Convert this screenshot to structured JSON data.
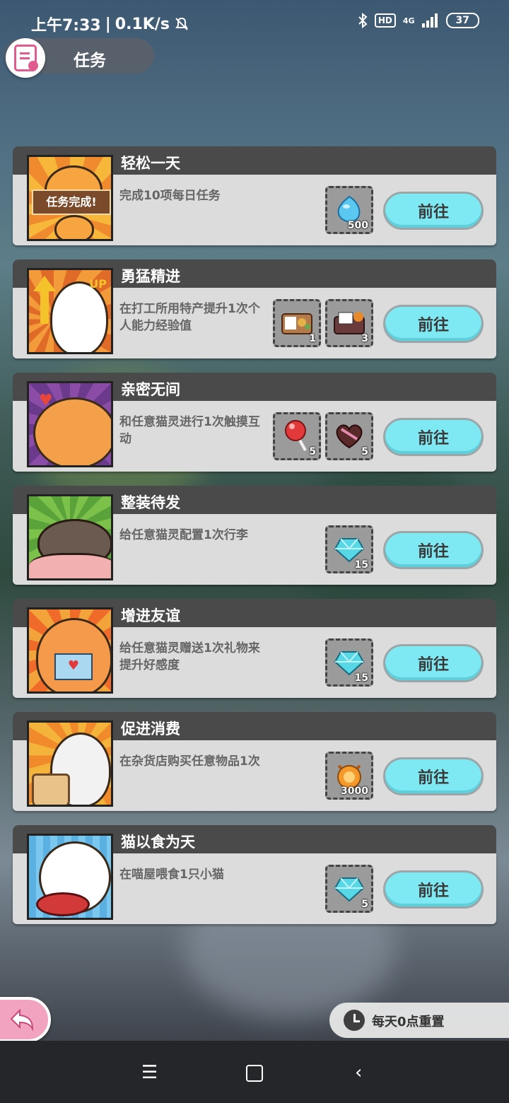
{
  "status_bar": {
    "time": "上午7:33",
    "speed": "0.1K/s",
    "hd": "HD",
    "network": "4G",
    "battery": "37"
  },
  "page": {
    "title": "任务"
  },
  "tasks": [
    {
      "name": "轻松一天",
      "desc": "完成10项每日任务",
      "thumb_text": "任务完成!",
      "button": "前往",
      "rewards": [
        {
          "icon": "blue-slime-icon",
          "count": "500"
        }
      ]
    },
    {
      "name": "勇猛精进",
      "desc": "在打工所用特产提升1次个人能力经验值",
      "thumb_text": "UP",
      "button": "前往",
      "rewards": [
        {
          "icon": "bento-box-icon",
          "count": "1"
        },
        {
          "icon": "gift-lunchbox-icon",
          "count": "3"
        }
      ]
    },
    {
      "name": "亲密无间",
      "desc": "和任意猫灵进行1次触摸互动",
      "button": "前往",
      "rewards": [
        {
          "icon": "lollipop-icon",
          "count": "5"
        },
        {
          "icon": "heart-chocolate-box-icon",
          "count": "5"
        }
      ]
    },
    {
      "name": "整装待发",
      "desc": "给任意猫灵配置1次行李",
      "button": "前往",
      "rewards": [
        {
          "icon": "cyan-gem-icon",
          "count": "15"
        }
      ]
    },
    {
      "name": "增进友谊",
      "desc": "给任意猫灵赠送1次礼物来提升好感度",
      "button": "前往",
      "rewards": [
        {
          "icon": "cyan-gem-icon",
          "count": "15"
        }
      ]
    },
    {
      "name": "促进消费",
      "desc": "在杂货店购买任意物品1次",
      "button": "前往",
      "rewards": [
        {
          "icon": "cat-coin-icon",
          "count": "3000"
        }
      ]
    },
    {
      "name": "猫以食为天",
      "desc": "在喵屋喂食1只小猫",
      "button": "前往",
      "rewards": [
        {
          "icon": "cyan-gem-icon",
          "count": "5"
        }
      ]
    }
  ],
  "footer": {
    "reset_text": "每天0点重置"
  },
  "colors": {
    "accent": "#7fe9f3",
    "header": "#4a4a4a",
    "card": "#dcdcdc",
    "pink": "#f2a3c0"
  }
}
